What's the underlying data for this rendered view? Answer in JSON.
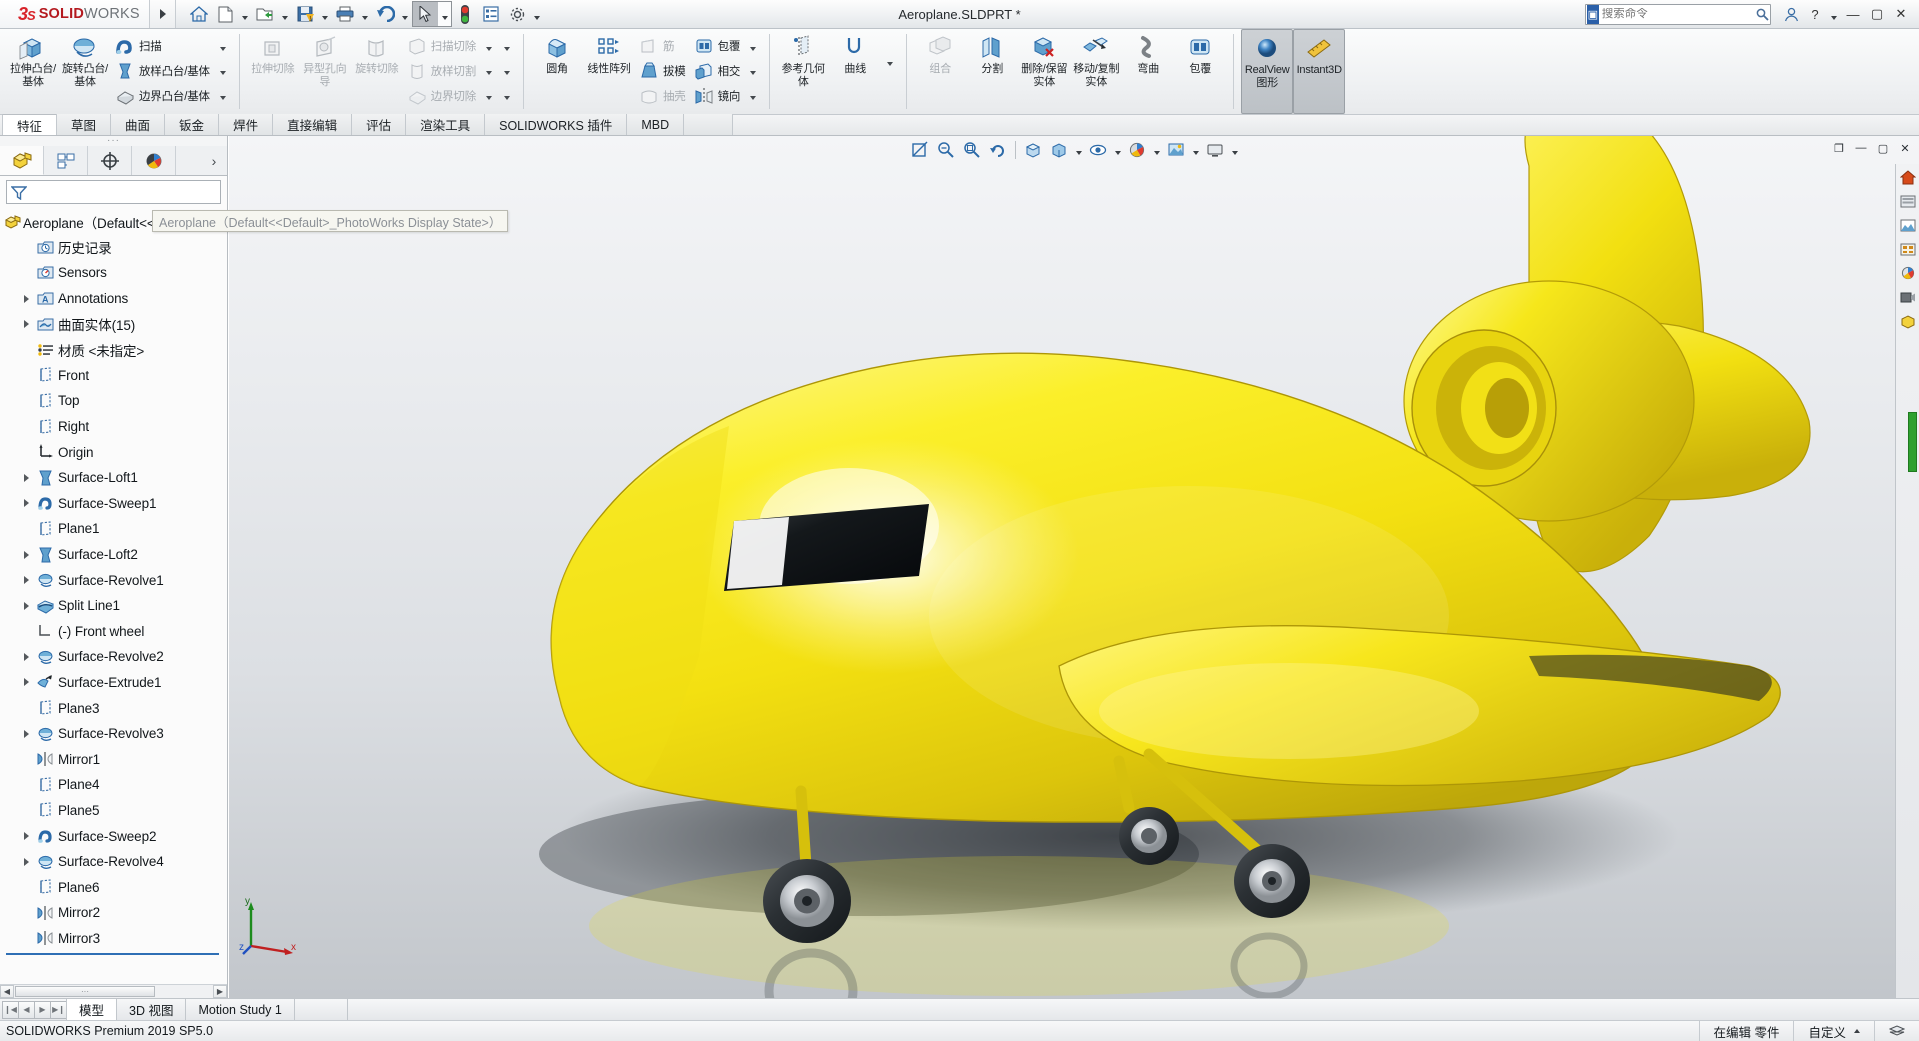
{
  "app": {
    "brand_bold": "SOLID",
    "brand_light": "WORKS",
    "document_title": "Aeroplane.SLDPRT *",
    "version_status": "SOLIDWORKS Premium 2019 SP5.0"
  },
  "titlebar": {
    "icons": [
      {
        "name": "home-icon",
        "glyph": "home"
      },
      {
        "name": "new-document-icon",
        "glyph": "new"
      },
      {
        "name": "open-document-icon",
        "glyph": "open"
      },
      {
        "name": "save-icon",
        "glyph": "save"
      },
      {
        "name": "print-icon",
        "glyph": "print"
      },
      {
        "name": "undo-icon",
        "glyph": "undo"
      },
      {
        "name": "select-icon",
        "glyph": "arrow"
      },
      {
        "name": "rebuild-icon",
        "glyph": "traffic"
      },
      {
        "name": "options-list-icon",
        "glyph": "list"
      },
      {
        "name": "settings-gear-icon",
        "glyph": "gear"
      }
    ],
    "search_placeholder": "搜索命令",
    "help_label": "?",
    "minimize_label": "—",
    "maximize_label": "▢",
    "close_label": "✕"
  },
  "ribbon": {
    "groups": [
      {
        "name": "boss-base-group",
        "big": [
          {
            "label": "拉伸凸台/基体",
            "icon": "extrude-boss-icon",
            "disabled": false
          },
          {
            "label": "旋转凸台/基体",
            "icon": "revolve-boss-icon",
            "disabled": false
          }
        ],
        "small": [
          {
            "label": "扫描",
            "icon": "sweep-icon",
            "disabled": false
          },
          {
            "label": "放样凸台/基体",
            "icon": "loft-boss-icon",
            "disabled": false
          },
          {
            "label": "边界凸台/基体",
            "icon": "boundary-boss-icon",
            "disabled": false
          }
        ]
      },
      {
        "name": "cut-group",
        "big": [
          {
            "label": "拉伸切除",
            "icon": "extrude-cut-icon",
            "disabled": true
          },
          {
            "label": "异型孔向导",
            "icon": "hole-wizard-icon",
            "disabled": true
          },
          {
            "label": "旋转切除",
            "icon": "revolve-cut-icon",
            "disabled": true
          }
        ],
        "small": [
          {
            "label": "扫描切除",
            "icon": "swept-cut-icon",
            "disabled": true
          },
          {
            "label": "放样切割",
            "icon": "lofted-cut-icon",
            "disabled": true
          },
          {
            "label": "边界切除",
            "icon": "boundary-cut-icon",
            "disabled": true
          }
        ]
      },
      {
        "name": "feature-group",
        "big": [
          {
            "label": "圆角",
            "icon": "fillet-icon",
            "disabled": false
          },
          {
            "label": "线性阵列",
            "icon": "linear-pattern-icon",
            "disabled": false
          }
        ],
        "small": [
          {
            "label": "筋",
            "icon": "rib-icon",
            "disabled": true
          },
          {
            "label": "拔模",
            "icon": "draft-icon",
            "disabled": false
          },
          {
            "label": "抽壳",
            "icon": "shell-icon",
            "disabled": true
          }
        ],
        "small2": [
          {
            "label": "包覆",
            "icon": "wrap-icon",
            "disabled": false
          },
          {
            "label": "相交",
            "icon": "intersect-icon",
            "disabled": false
          },
          {
            "label": "镜向",
            "icon": "mirror-icon",
            "disabled": false
          }
        ]
      },
      {
        "name": "reference-group",
        "big": [
          {
            "label": "参考几何体",
            "icon": "reference-geometry-icon",
            "disabled": false
          },
          {
            "label": "曲线",
            "icon": "curves-icon",
            "disabled": false
          }
        ]
      },
      {
        "name": "bodies-group",
        "big": [
          {
            "label": "组合",
            "icon": "combine-icon",
            "disabled": true
          },
          {
            "label": "分割",
            "icon": "split-icon",
            "disabled": false
          },
          {
            "label": "删除/保留实体",
            "icon": "delete-keep-body-icon",
            "disabled": false
          },
          {
            "label": "移动/复制实体",
            "icon": "move-copy-body-icon",
            "disabled": false
          },
          {
            "label": "弯曲",
            "icon": "flex-icon",
            "disabled": false
          },
          {
            "label": "包覆",
            "icon": "wrap2-icon",
            "disabled": false
          }
        ]
      },
      {
        "name": "display-group",
        "big": [
          {
            "label": "RealView 图形",
            "icon": "realview-sphere-icon",
            "disabled": false,
            "active": true
          },
          {
            "label": "Instant3D",
            "icon": "instant3d-icon",
            "disabled": false,
            "active": true
          }
        ]
      }
    ]
  },
  "command_tabs": {
    "items": [
      {
        "label": "特征",
        "active": true
      },
      {
        "label": "草图",
        "active": false
      },
      {
        "label": "曲面",
        "active": false
      },
      {
        "label": "钣金",
        "active": false
      },
      {
        "label": "焊件",
        "active": false
      },
      {
        "label": "直接编辑",
        "active": false
      },
      {
        "label": "评估",
        "active": false
      },
      {
        "label": "渲染工具",
        "active": false
      },
      {
        "label": "SOLIDWORKS 插件",
        "active": false
      },
      {
        "label": "MBD",
        "active": false
      }
    ]
  },
  "tree_panel": {
    "tabs": [
      {
        "name": "feature-manager-tab",
        "icon": "feature-tree-icon",
        "active": true
      },
      {
        "name": "property-manager-tab",
        "icon": "property-manager-icon",
        "active": false
      },
      {
        "name": "configuration-manager-tab",
        "icon": "configuration-icon",
        "active": false
      },
      {
        "name": "display-manager-tab",
        "icon": "display-manager-icon",
        "active": false
      }
    ],
    "more_label": "›",
    "filter_placeholder": "",
    "tooltip": "Aeroplane（Default<<Default>_PhotoWorks Display State>）",
    "nodes": [
      {
        "label": "Aeroplane（Default<<Default>_Ph",
        "icon": "part-icon",
        "indent": 0,
        "expand": false,
        "root": true
      },
      {
        "label": "历史记录",
        "icon": "history-icon",
        "indent": 1,
        "expand": false
      },
      {
        "label": "Sensors",
        "icon": "sensors-icon",
        "indent": 1,
        "expand": false
      },
      {
        "label": "Annotations",
        "icon": "annotations-icon",
        "indent": 1,
        "expand": true
      },
      {
        "label": "曲面实体(15)",
        "icon": "surface-bodies-icon",
        "indent": 1,
        "expand": true
      },
      {
        "label": "材质 <未指定>",
        "icon": "material-icon",
        "indent": 1,
        "expand": false
      },
      {
        "label": "Front",
        "icon": "plane-icon",
        "indent": 1,
        "expand": false
      },
      {
        "label": "Top",
        "icon": "plane-icon",
        "indent": 1,
        "expand": false
      },
      {
        "label": "Right",
        "icon": "plane-icon",
        "indent": 1,
        "expand": false
      },
      {
        "label": "Origin",
        "icon": "origin-icon",
        "indent": 1,
        "expand": false
      },
      {
        "label": "Surface-Loft1",
        "icon": "loft-icon",
        "indent": 1,
        "expand": true
      },
      {
        "label": "Surface-Sweep1",
        "icon": "sweep-icon",
        "indent": 1,
        "expand": true
      },
      {
        "label": "Plane1",
        "icon": "plane-icon",
        "indent": 1,
        "expand": false
      },
      {
        "label": "Surface-Loft2",
        "icon": "loft-icon",
        "indent": 1,
        "expand": true
      },
      {
        "label": "Surface-Revolve1",
        "icon": "revolve-icon",
        "indent": 1,
        "expand": true
      },
      {
        "label": "Split Line1",
        "icon": "split-line-icon",
        "indent": 1,
        "expand": true
      },
      {
        "label": "(-) Front wheel",
        "icon": "sketch-icon",
        "indent": 1,
        "expand": false
      },
      {
        "label": "Surface-Revolve2",
        "icon": "revolve-icon",
        "indent": 1,
        "expand": true
      },
      {
        "label": "Surface-Extrude1",
        "icon": "extrude-surface-icon",
        "indent": 1,
        "expand": true
      },
      {
        "label": "Plane3",
        "icon": "plane-icon",
        "indent": 1,
        "expand": false
      },
      {
        "label": "Surface-Revolve3",
        "icon": "revolve-icon",
        "indent": 1,
        "expand": true
      },
      {
        "label": "Mirror1",
        "icon": "mirror-icon",
        "indent": 1,
        "expand": false
      },
      {
        "label": "Plane4",
        "icon": "plane-icon",
        "indent": 1,
        "expand": false
      },
      {
        "label": "Plane5",
        "icon": "plane-icon",
        "indent": 1,
        "expand": false
      },
      {
        "label": "Surface-Sweep2",
        "icon": "sweep-icon",
        "indent": 1,
        "expand": true
      },
      {
        "label": "Surface-Revolve4",
        "icon": "revolve-icon",
        "indent": 1,
        "expand": true
      },
      {
        "label": "Plane6",
        "icon": "plane-icon",
        "indent": 1,
        "expand": false
      },
      {
        "label": "Mirror2",
        "icon": "mirror-icon",
        "indent": 1,
        "expand": false
      },
      {
        "label": "Mirror3",
        "icon": "mirror-icon",
        "indent": 1,
        "expand": false
      }
    ]
  },
  "graphics": {
    "toolbar_icons": [
      {
        "name": "section-view-icon"
      },
      {
        "name": "zoom-to-fit-icon"
      },
      {
        "name": "zoom-to-area-icon"
      },
      {
        "name": "previous-view-icon"
      },
      {
        "name": "view-orientation-icon"
      },
      {
        "name": "display-style-icon"
      },
      {
        "name": "hide-show-items-icon"
      },
      {
        "name": "edit-appearance-icon"
      },
      {
        "name": "apply-scene-icon"
      },
      {
        "name": "view-settings-icon"
      }
    ],
    "window_buttons": [
      {
        "name": "restore-window-button",
        "glyph": "❐"
      },
      {
        "name": "minimize-window-button",
        "glyph": "—"
      },
      {
        "name": "maximize-window-button",
        "glyph": "▢"
      },
      {
        "name": "close-window-button",
        "glyph": "✕"
      }
    ],
    "right_dock_icons": [
      {
        "name": "home-panel-icon"
      },
      {
        "name": "appearances-panel-icon"
      },
      {
        "name": "scenes-panel-icon"
      },
      {
        "name": "decals-panel-icon"
      },
      {
        "name": "lights-panel-icon"
      },
      {
        "name": "cameras-panel-icon"
      },
      {
        "name": "custom-panel-icon"
      }
    ],
    "triad_labels": {
      "x": "x",
      "y": "y",
      "z": "z"
    },
    "model_description": "Yellow cartoon aeroplane 3D model with propeller, canopy window, and landing gear wheels"
  },
  "bottom": {
    "nav_buttons": [
      {
        "name": "first-tab-button",
        "glyph": "❙◀"
      },
      {
        "name": "prev-tab-button",
        "glyph": "◀"
      },
      {
        "name": "next-tab-button",
        "glyph": "▶"
      },
      {
        "name": "last-tab-button",
        "glyph": "▶❙"
      }
    ],
    "tabs": [
      {
        "label": "模型",
        "active": true
      },
      {
        "label": "3D 视图",
        "active": false
      },
      {
        "label": "Motion Study 1",
        "active": false
      }
    ]
  },
  "status": {
    "left": "SOLIDWORKS Premium 2019 SP5.0",
    "editing": "在编辑 零件",
    "custom": "自定义",
    "tail_icon": "layers-icon"
  },
  "colors": {
    "accent_blue": "#2f6fb5",
    "brand_red": "#b4191f",
    "model_yellow": "#f5e416",
    "ribbon_bg": "#eef0f2",
    "scroll_green": "#2fa02f"
  }
}
